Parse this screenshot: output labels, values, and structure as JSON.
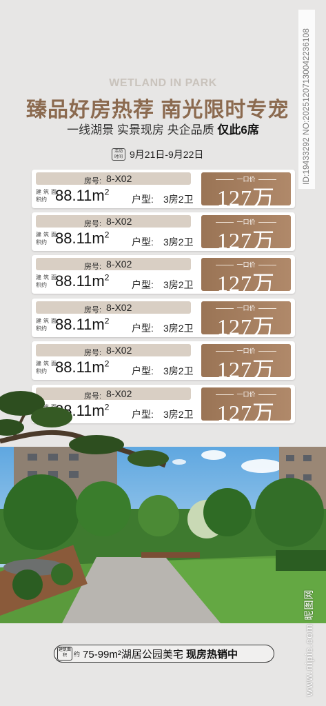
{
  "header": {
    "subtitle_en": "WETLAND IN PARK",
    "title": "臻品好房热荐 南光限时专宠",
    "tagline": "一线湖景 实景现房 央企品质",
    "tagline_emphasis": "仅此6席"
  },
  "promo": {
    "badge": "活动时间",
    "dates": "9月21日-9月22日"
  },
  "listings": [
    {
      "room_label": "房号:",
      "room": "8-X02",
      "area_label": "建 筑 面积约",
      "area": "88.11m",
      "area_unit_sup": "2",
      "type_label": "户型:",
      "type": "3房2卫",
      "price_label": "一口价",
      "price": "127万"
    },
    {
      "room_label": "房号:",
      "room": "8-X02",
      "area_label": "建 筑 面积约",
      "area": "88.11m",
      "area_unit_sup": "2",
      "type_label": "户型:",
      "type": "3房2卫",
      "price_label": "一口价",
      "price": "127万"
    },
    {
      "room_label": "房号:",
      "room": "8-X02",
      "area_label": "建 筑 面积约",
      "area": "88.11m",
      "area_unit_sup": "2",
      "type_label": "户型:",
      "type": "3房2卫",
      "price_label": "一口价",
      "price": "127万"
    },
    {
      "room_label": "房号:",
      "room": "8-X02",
      "area_label": "建 筑 面积约",
      "area": "88.11m",
      "area_unit_sup": "2",
      "type_label": "户型:",
      "type": "3房2卫",
      "price_label": "一口价",
      "price": "127万"
    },
    {
      "room_label": "房号:",
      "room": "8-X02",
      "area_label": "建 筑 面积约",
      "area": "88.11m",
      "area_unit_sup": "2",
      "type_label": "户型:",
      "type": "3房2卫",
      "price_label": "一口价",
      "price": "127万"
    },
    {
      "room_label": "房号:",
      "room": "8-X02",
      "area_label": "建 筑 面积约",
      "area": "88.11m",
      "area_unit_sup": "2",
      "type_label": "户型:",
      "type": "3房2卫",
      "price_label": "一口价",
      "price": "127万"
    }
  ],
  "footer": {
    "badge": "建筑面积",
    "prefix": "约",
    "range": "75-99m²湖居公园美宅",
    "emphasis": "现房热销中"
  },
  "watermark": {
    "id": "ID:19433292 NO:20251207130042236108",
    "site": "www.nipic.com",
    "brand": "昵图网"
  },
  "colors": {
    "accent": "#8b6a4f",
    "price_bg": "#a27c5c",
    "tag_bg": "#d9cfc4",
    "page_bg": "#e7e6e5"
  }
}
